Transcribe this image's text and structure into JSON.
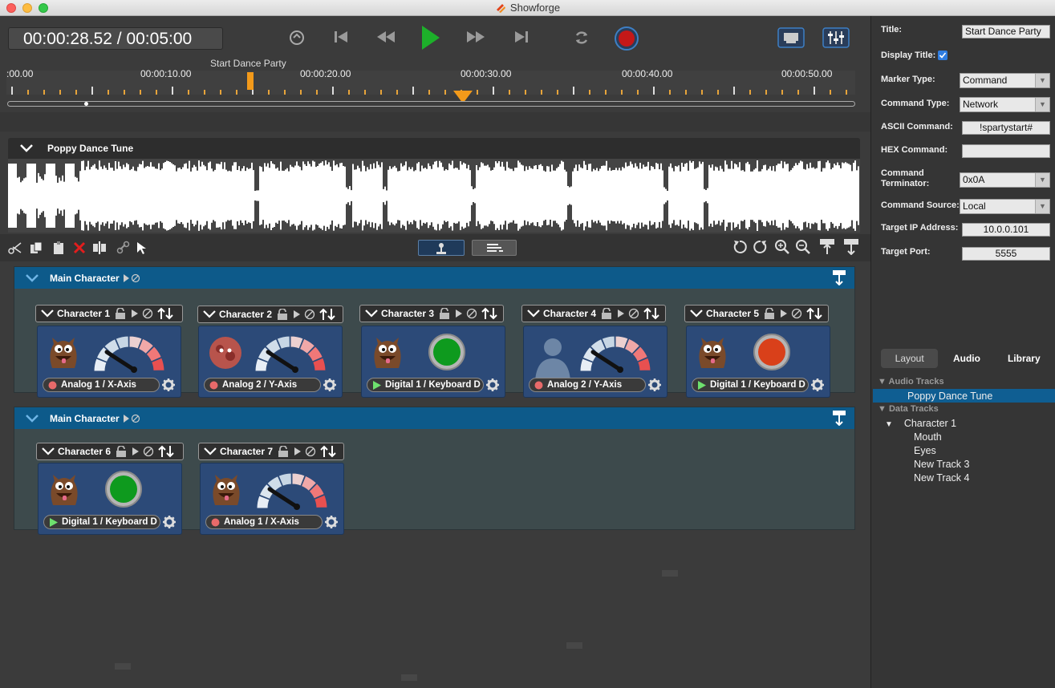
{
  "window": {
    "title": "Showforge"
  },
  "transport": {
    "current_time": "00:00:28.52",
    "total_time": "/ 00:05:00"
  },
  "timeline": {
    "labels": [
      ":00.00",
      "00:00:10.00",
      "00:00:20.00",
      "00:00:30.00",
      "00:00:40.00",
      "00:00:50.00"
    ],
    "marker_label": "Start Dance Party"
  },
  "audio_track": {
    "name": "Poppy Dance Tune"
  },
  "groups": [
    {
      "title": "Main Character",
      "characters": [
        {
          "name": "Character 1",
          "input": "Analog 1 / X-Axis",
          "type": "analog"
        },
        {
          "name": "Character 2",
          "input": "Analog 2 / Y-Axis",
          "type": "analog"
        },
        {
          "name": "Character 3",
          "input": "Digital 1 / Keyboard D",
          "type": "digital"
        },
        {
          "name": "Character 4",
          "input": "Analog 2 / Y-Axis",
          "type": "analog"
        },
        {
          "name": "Character 5",
          "input": "Digital 1 / Keyboard D",
          "type": "digital"
        }
      ]
    },
    {
      "title": "Main Character",
      "characters": [
        {
          "name": "Character 6",
          "input": "Digital 1 / Keyboard D",
          "type": "digital"
        },
        {
          "name": "Character 7",
          "input": "Analog 1 / X-Axis",
          "type": "analog"
        }
      ]
    }
  ],
  "properties": {
    "title_label": "Title:",
    "title_value": "Start Dance Party",
    "display_title_label": "Display Title:",
    "marker_type_label": "Marker Type:",
    "marker_type_value": "Command",
    "command_type_label": "Command Type:",
    "command_type_value": "Network",
    "ascii_label": "ASCII Command:",
    "ascii_value": "!spartystart#",
    "hex_label": "HEX Command:",
    "hex_value": "",
    "terminator_label": "Command Terminator:",
    "terminator_value": "0x0A",
    "source_label": "Command Source:",
    "source_value": "Local",
    "ip_label": "Target IP Address:",
    "ip_value": "10.0.0.101",
    "port_label": "Target Port:",
    "port_value": "5555"
  },
  "tabs": [
    "Layout",
    "Audio",
    "Library"
  ],
  "tree": {
    "audio_header": "Audio Tracks",
    "audio_items": [
      "Poppy Dance Tune"
    ],
    "data_header": "Data Tracks",
    "character": "Character 1",
    "tracks": [
      "Mouth",
      "Eyes",
      "New Track 3",
      "New Track 4"
    ]
  },
  "colors": {
    "accent": "#0d5a8a",
    "record": "#c41818",
    "play": "#1db02a",
    "marker": "#f39a1a"
  }
}
